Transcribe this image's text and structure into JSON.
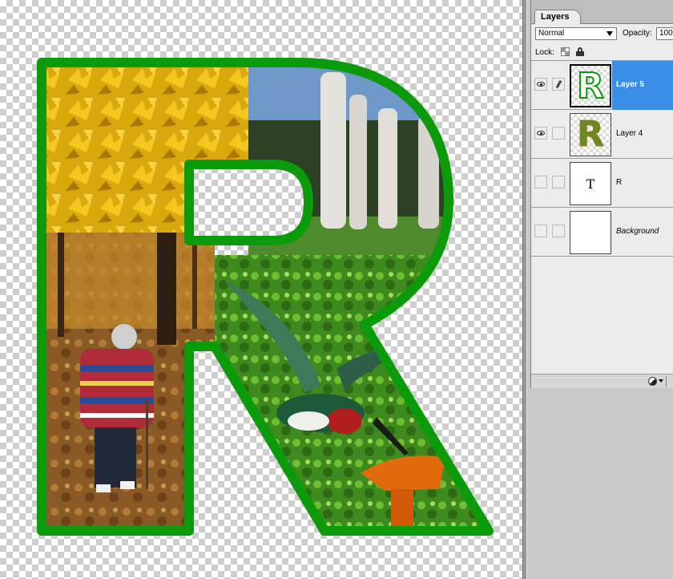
{
  "canvas": {
    "letter": "R",
    "outline_color": "#0a9a0a",
    "photo_regions": [
      "yellow-autumn-leaves",
      "stone-columns-park",
      "autumn-forest-walker",
      "lego-hummingbird-garden"
    ]
  },
  "layers_panel": {
    "tab_label": "Layers",
    "blend_mode": "Normal",
    "opacity_label": "Opacity:",
    "opacity_value": "100",
    "lock_label": "Lock:",
    "selected_color": "#3a8ee6",
    "layers": [
      {
        "name": "Layer 5",
        "visible": true,
        "selected": true,
        "brush_link": true,
        "thumb": "R-outline"
      },
      {
        "name": "Layer 4",
        "visible": true,
        "selected": false,
        "brush_link": false,
        "thumb": "R-photo"
      },
      {
        "name": "R",
        "visible": false,
        "selected": false,
        "brush_link": false,
        "thumb": "T",
        "thumb_label": "T"
      },
      {
        "name": "Background",
        "visible": false,
        "selected": false,
        "brush_link": false,
        "thumb": "white"
      }
    ]
  }
}
